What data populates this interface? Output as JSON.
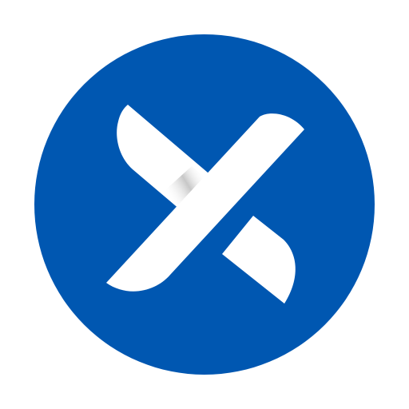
{
  "icon": {
    "name": "x-logo",
    "colors": {
      "background": "#ffffff",
      "circle": "#0057B1",
      "mark": "#ffffff",
      "shadow": "#c9c9c9"
    }
  }
}
